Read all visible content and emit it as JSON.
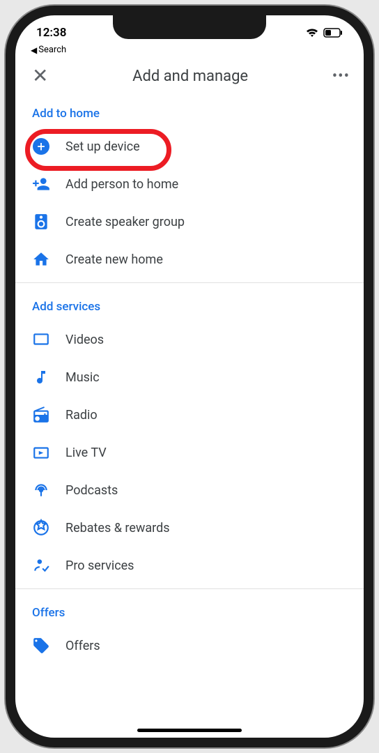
{
  "status": {
    "time": "12:38",
    "wifi": true,
    "battery_level": 35
  },
  "breadcrumb": {
    "back_label": "Search"
  },
  "header": {
    "title": "Add and manage"
  },
  "sections": {
    "add_to_home": {
      "title": "Add to home",
      "items": [
        {
          "icon": "plus-circle-icon",
          "label": "Set up device",
          "highlighted": true
        },
        {
          "icon": "person-add-icon",
          "label": "Add person to home"
        },
        {
          "icon": "speaker-group-icon",
          "label": "Create speaker group"
        },
        {
          "icon": "home-icon",
          "label": "Create new home"
        }
      ]
    },
    "add_services": {
      "title": "Add services",
      "items": [
        {
          "icon": "video-icon",
          "label": "Videos"
        },
        {
          "icon": "music-icon",
          "label": "Music"
        },
        {
          "icon": "radio-icon",
          "label": "Radio"
        },
        {
          "icon": "live-tv-icon",
          "label": "Live TV"
        },
        {
          "icon": "podcast-icon",
          "label": "Podcasts"
        },
        {
          "icon": "rewards-icon",
          "label": "Rebates & rewards"
        },
        {
          "icon": "pro-services-icon",
          "label": "Pro services"
        }
      ]
    },
    "offers": {
      "title": "Offers",
      "items": [
        {
          "icon": "offer-tag-icon",
          "label": "Offers"
        }
      ]
    }
  }
}
